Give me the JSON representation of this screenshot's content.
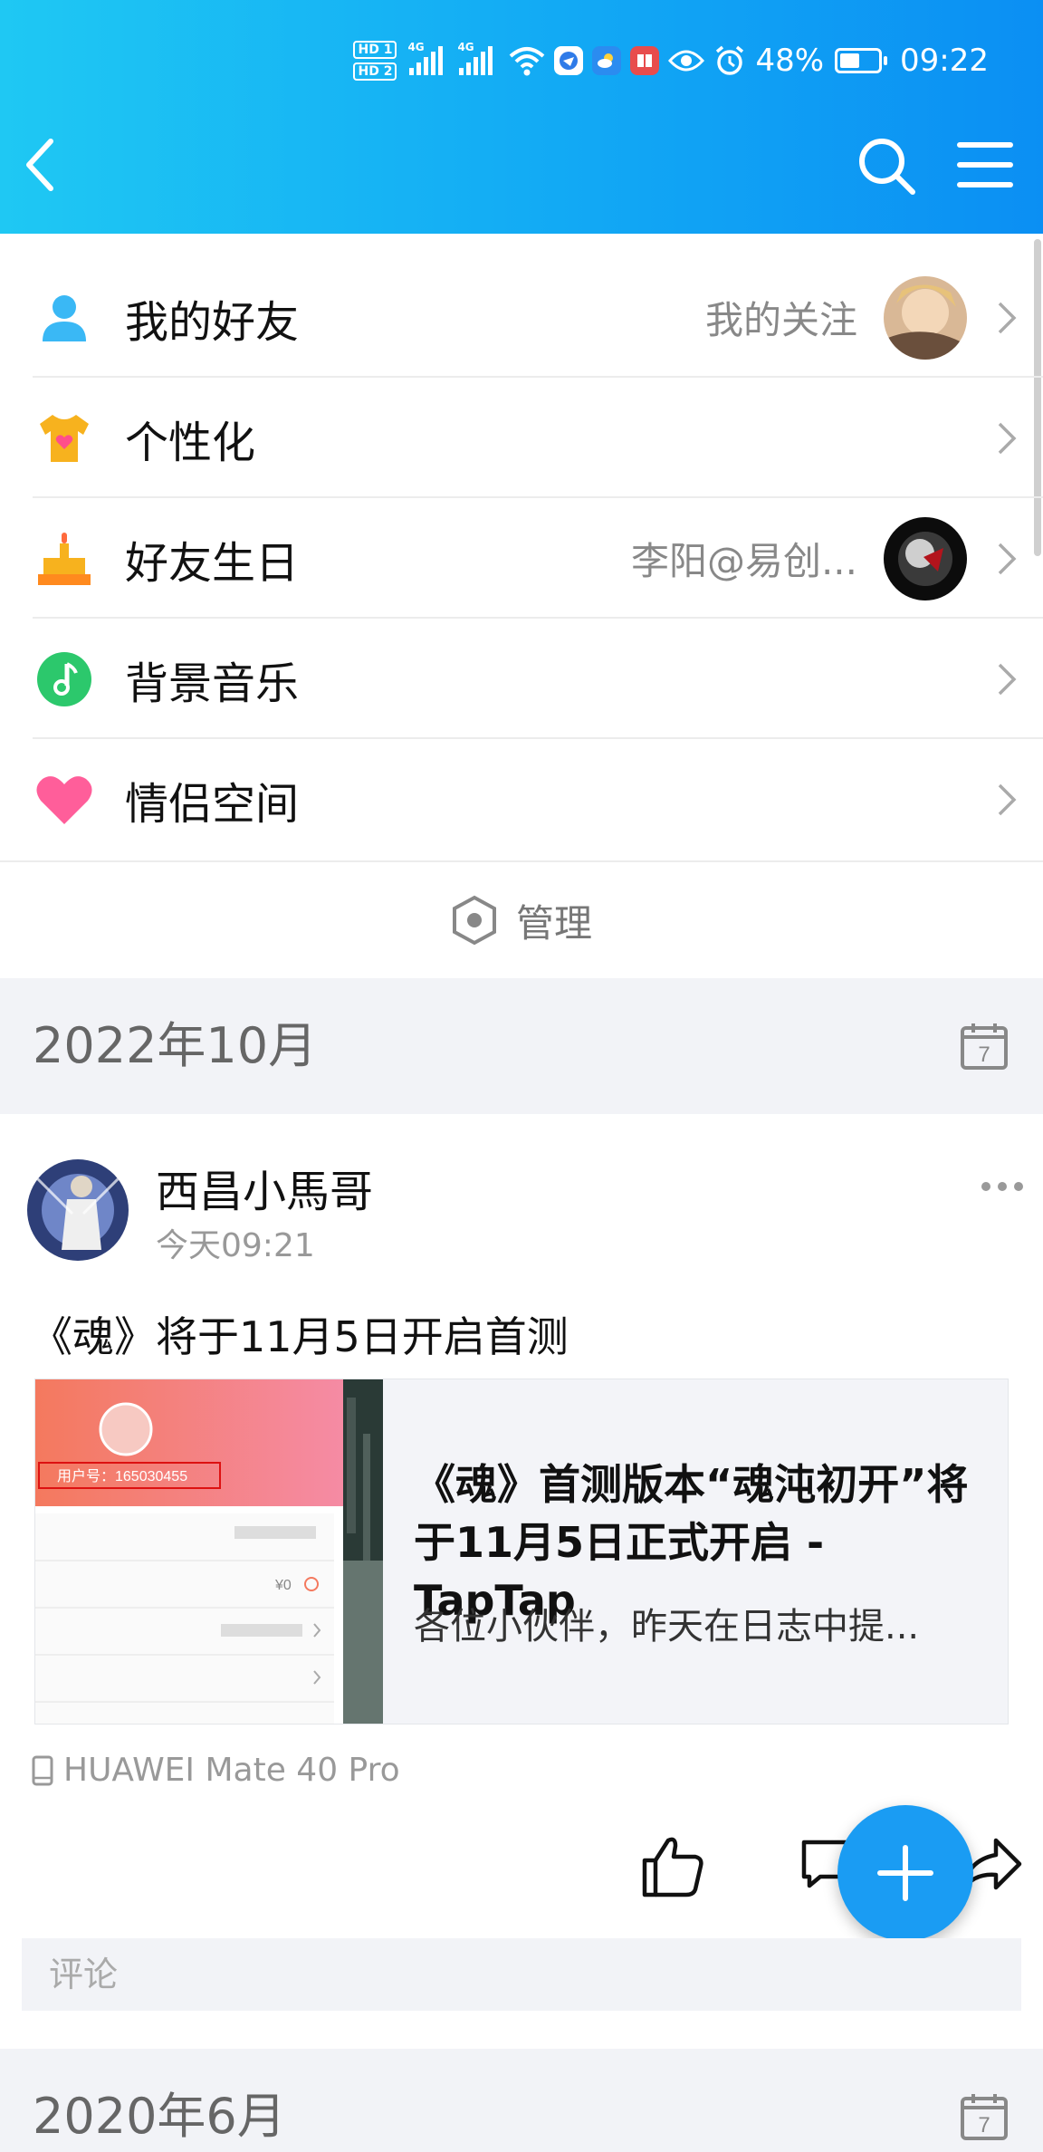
{
  "status_bar": {
    "hd1": "HD 1",
    "hd2": "HD 2",
    "net1": "4G",
    "net2": "4G",
    "battery_percent": "48%",
    "battery_level": 0.48,
    "time": "09:22"
  },
  "colors": {
    "header_start": "#1fc8f3",
    "header_end": "#0b8ff3",
    "fab": "#1a9cf3",
    "friends_icon": "#3ab8f5",
    "birthday_icon": "#f5a623",
    "music_icon": "#2cc86c",
    "couple_icon": "#ff5e9a"
  },
  "menu": {
    "items": [
      {
        "label": "我的好友",
        "right_text": "我的关注"
      },
      {
        "label": "个性化",
        "right_text": ""
      },
      {
        "label": "好友生日",
        "right_text": "李阳@易创..."
      },
      {
        "label": "背景音乐",
        "right_text": ""
      },
      {
        "label": "情侣空间",
        "right_text": ""
      }
    ],
    "manage_label": "管理"
  },
  "months": [
    {
      "label": "2022年10月",
      "calendar_day": "7"
    },
    {
      "label": "2020年6月",
      "calendar_day": "7"
    }
  ],
  "post": {
    "author": "西昌小馬哥",
    "time": "今天09:21",
    "text": "《魂》将于11月5日开启首测",
    "link": {
      "title": "《魂》首测版本“魂沌初开”将于11月5日正式开启 - TapTap",
      "desc": "各位小伙伴，昨天在日志中提...",
      "thumb_user_id": "用户号：165030455",
      "thumb_balance": "¥0"
    },
    "device": "HUAWEI Mate 40 Pro",
    "comment_placeholder": "评论"
  }
}
